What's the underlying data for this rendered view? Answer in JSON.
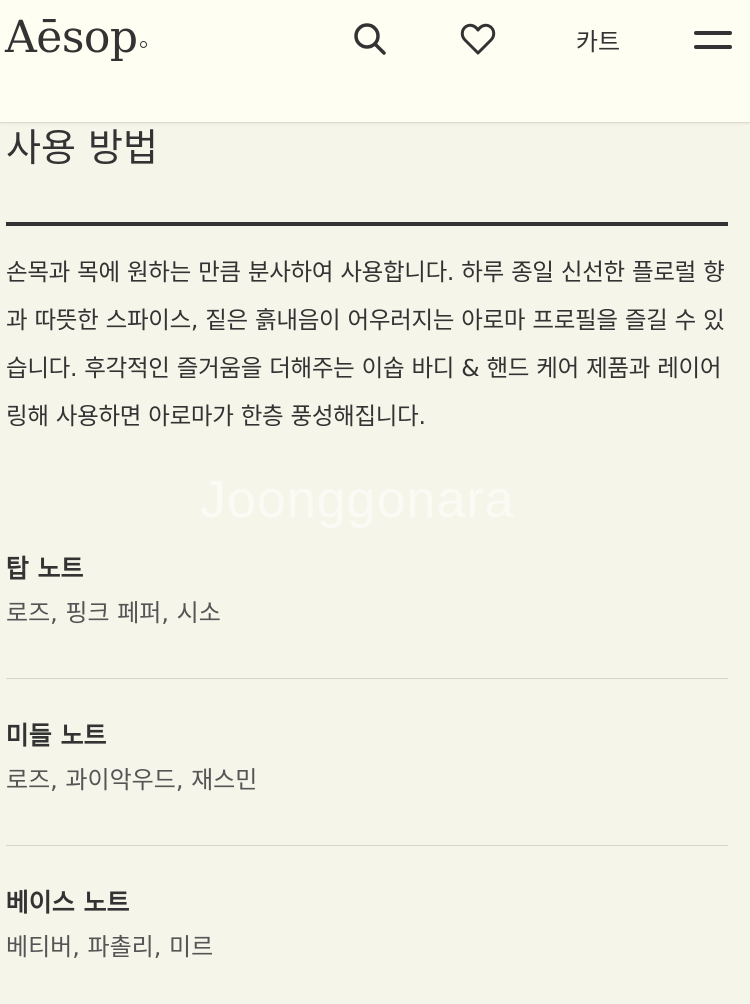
{
  "header": {
    "logo": "Aēsop",
    "cart_label": "카트"
  },
  "section": {
    "title": "사용 방법",
    "description": "손목과 목에 원하는 만큼 분사하여 사용합니다. 하루 종일 신선한 플로럴 향과 따뜻한 스파이스, 짙은 흙내음이 어우러지는 아로마 프로필을 즐길 수 있습니다. 후각적인 즐거움을 더해주는 이솝 바디 & 핸드 케어 제품과 레이어링해 사용하면 아로마가 한층 풍성해집니다."
  },
  "notes": [
    {
      "title": "탑 노트",
      "value": "로즈, 핑크 페퍼, 시소"
    },
    {
      "title": "미들 노트",
      "value": "로즈, 과이악우드, 재스민"
    },
    {
      "title": "베이스 노트",
      "value": "베티버, 파촐리, 미르"
    }
  ],
  "watermark": "Joonggonara"
}
